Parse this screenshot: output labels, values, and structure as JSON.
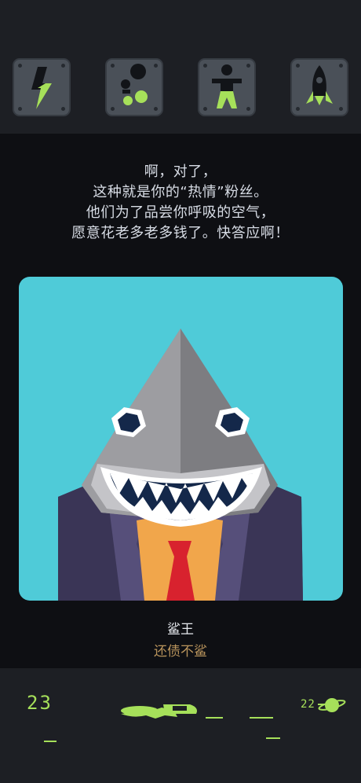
{
  "toolbar": {
    "items": [
      {
        "icon": "lightning-bolt-icon"
      },
      {
        "icon": "bubbles-icon"
      },
      {
        "icon": "person-icon"
      },
      {
        "icon": "rocket-icon"
      }
    ]
  },
  "story": {
    "lines": [
      "啊，对了，",
      "这种就是你的“热情”粉丝。",
      "他们为了品尝你呼吸的空气，",
      "愿意花老多老多钱了。快答应啊！"
    ]
  },
  "character": {
    "name": "鲨王",
    "description": "还债不鲨",
    "portrait_icon": "shark-businessman-portrait"
  },
  "status": {
    "left_count": "23",
    "right_count": "22",
    "right_icon": "planet-icon",
    "center_icon": "spaceship-progress-icon"
  },
  "colors": {
    "accent_green": "#a6e05a",
    "portrait_bg": "#4fcbd8",
    "desc_gold": "#b9945c",
    "tie_red": "#d8222e"
  }
}
